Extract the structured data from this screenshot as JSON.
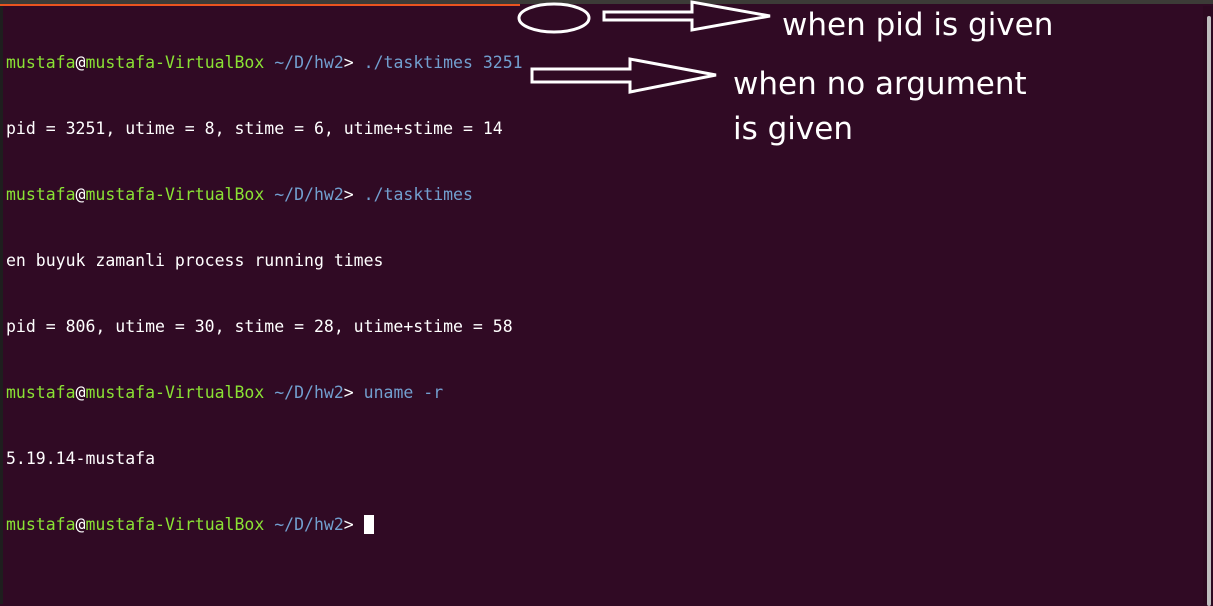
{
  "terminal": {
    "lines": [
      {
        "user": "mustafa",
        "at": "@",
        "host": "mustafa-VirtualBox",
        "path": "~/D/hw2",
        "prompt": ">",
        "command": "./tasktimes",
        "arg": "3251"
      },
      {
        "output": "pid = 3251, utime = 8, stime = 6, utime+stime = 14"
      },
      {
        "user": "mustafa",
        "at": "@",
        "host": "mustafa-VirtualBox",
        "path": "~/D/hw2",
        "prompt": ">",
        "command": "./tasktimes"
      },
      {
        "output": "en buyuk zamanli process running times"
      },
      {
        "output": "pid = 806, utime = 30, stime = 28, utime+stime = 58"
      },
      {
        "user": "mustafa",
        "at": "@",
        "host": "mustafa-VirtualBox",
        "path": "~/D/hw2",
        "prompt": ">",
        "command": "uname -r"
      },
      {
        "output": "5.19.14-mustafa"
      },
      {
        "user": "mustafa",
        "at": "@",
        "host": "mustafa-VirtualBox",
        "path": "~/D/hw2",
        "prompt": ">"
      }
    ]
  },
  "annotations": {
    "pid_given": "when pid is given",
    "no_argument_line1": "when no argument",
    "no_argument_line2": "is given"
  },
  "colors": {
    "background": "#300a24",
    "user_host": "#8ae234",
    "path_command": "#729fcf",
    "text": "#ffffff",
    "accent": "#e95420"
  }
}
